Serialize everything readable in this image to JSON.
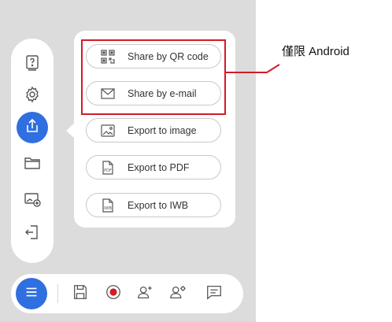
{
  "share_menu": {
    "items": [
      {
        "label": "Share by QR code",
        "icon": "qr-code-icon"
      },
      {
        "label": "Share by e-mail",
        "icon": "mail-icon"
      },
      {
        "label": "Export to image",
        "icon": "image-file-icon"
      },
      {
        "label": "Export to PDF",
        "icon": "pdf-file-icon"
      },
      {
        "label": "Export to IWB",
        "icon": "iwb-file-icon"
      }
    ],
    "pdf_badge": "PDF",
    "iwb_badge": "IWB"
  },
  "annotation": {
    "text": "僅限 Android",
    "color": "#d11b2a"
  },
  "side_toolbar": {
    "items": [
      "help-icon",
      "settings-gear-icon",
      "share-upload-icon",
      "folder-icon",
      "add-slide-icon",
      "exit-icon"
    ],
    "active": "share-upload-icon"
  },
  "bottom_toolbar": {
    "items": [
      "menu-icon",
      "save-icon",
      "record-icon",
      "add-user-icon",
      "user-settings-icon",
      "chat-icon"
    ]
  },
  "colors": {
    "accent": "#2f6fe0",
    "record": "#d11b2a",
    "background": "#dcdcdc"
  }
}
